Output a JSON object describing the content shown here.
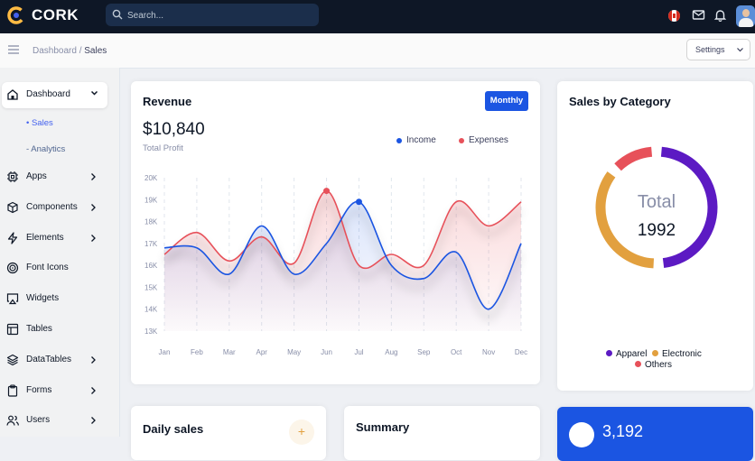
{
  "header": {
    "brand": "CORK",
    "search_placeholder": "Search..."
  },
  "breadcrumb": {
    "parent": "Dashboard",
    "separator": "/",
    "current": "Sales"
  },
  "settings_label": "Settings",
  "sidebar": {
    "items": [
      {
        "label": "Dashboard",
        "icon": "home-icon"
      },
      {
        "label": "Apps",
        "icon": "cpu-icon"
      },
      {
        "label": "Components",
        "icon": "box-icon"
      },
      {
        "label": "Elements",
        "icon": "zap-icon"
      },
      {
        "label": "Font Icons",
        "icon": "target-icon"
      },
      {
        "label": "Widgets",
        "icon": "airplay-icon"
      },
      {
        "label": "Tables",
        "icon": "layout-icon"
      },
      {
        "label": "DataTables",
        "icon": "layers-icon"
      },
      {
        "label": "Forms",
        "icon": "clipboard-icon"
      },
      {
        "label": "Users",
        "icon": "users-icon"
      }
    ],
    "sub_items": [
      {
        "label": "Sales",
        "active": true
      },
      {
        "label": "Analytics",
        "active": false
      }
    ]
  },
  "revenue": {
    "title": "Revenue",
    "period_button": "Monthly",
    "amount": "$10,840",
    "amount_label": "Total Profit",
    "legend": [
      {
        "label": "Income",
        "color": "#1b55e2"
      },
      {
        "label": "Expenses",
        "color": "#e7515a"
      }
    ]
  },
  "chart_data": {
    "type": "area",
    "categories": [
      "Jan",
      "Feb",
      "Mar",
      "Apr",
      "May",
      "Jun",
      "Jul",
      "Aug",
      "Sep",
      "Oct",
      "Nov",
      "Dec"
    ],
    "y_ticks": [
      "13K",
      "14K",
      "15K",
      "16K",
      "17K",
      "18K",
      "19K",
      "20K"
    ],
    "ylim": [
      13000,
      20000
    ],
    "series": [
      {
        "name": "Income",
        "color": "#1b55e2",
        "values": [
          16800,
          16800,
          15600,
          17800,
          15600,
          17000,
          18900,
          16000,
          15400,
          16600,
          14000,
          17000
        ]
      },
      {
        "name": "Expenses",
        "color": "#e7515a",
        "values": [
          16500,
          17500,
          16200,
          17300,
          16100,
          19400,
          16000,
          16500,
          16000,
          18900,
          17800,
          18900
        ]
      }
    ],
    "highlight_points": [
      {
        "series": "Expenses",
        "x": "Jun",
        "y": 19400
      },
      {
        "series": "Income",
        "x": "Jul",
        "y": 18900
      }
    ]
  },
  "category": {
    "title": "Sales by Category",
    "total_label": "Total",
    "total_value": "1992",
    "legend": [
      {
        "label": "Apparel",
        "color": "#5c1ac3",
        "value": 985
      },
      {
        "label": "Electronic",
        "color": "#e2a03f",
        "value": 737
      },
      {
        "label": "Others",
        "color": "#e7515a",
        "value": 270
      }
    ]
  },
  "daily_sales": {
    "title": "Daily sales",
    "button_glyph": "+"
  },
  "summary": {
    "title": "Summary"
  },
  "total_orders": {
    "value": "3,192"
  }
}
